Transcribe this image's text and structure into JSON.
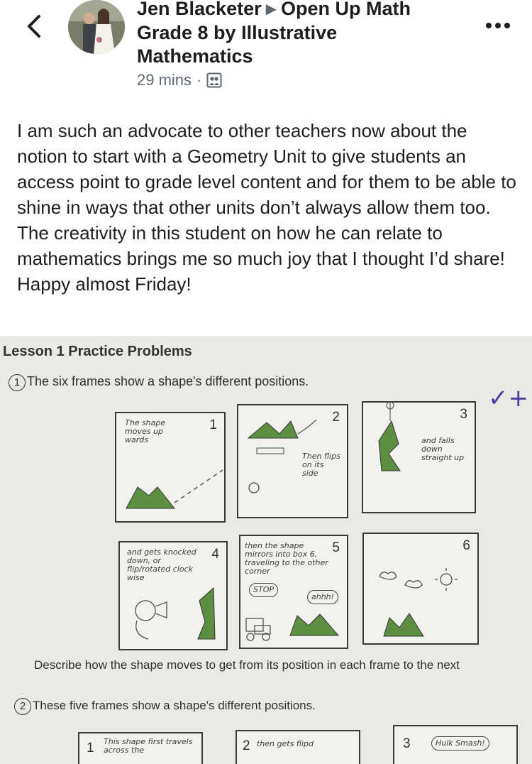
{
  "header": {
    "author": "Jen Blacketer",
    "group_line1": "Open Up Math",
    "group_line2": "Grade 8 by Illustrative",
    "group_line3": "Mathematics",
    "time": "29 mins",
    "dot": "·"
  },
  "post": {
    "text": "I am such an advocate to other teachers now about the notion to start with a Geometry Unit to give students an access point to grade level content and for them to be able to shine in ways that other units don’t always allow them too. The creativity in this student on how he can relate to mathematics brings me so much joy that I thought I’d share! Happy almost Friday!"
  },
  "worksheet": {
    "title": "Lesson 1 Practice Problems",
    "q1_num": "1",
    "q1_text": "The six frames show a shape's different positions.",
    "describe": "Describe how the shape moves to get from its position in each frame to the next",
    "q2_num": "2",
    "q2_text": "These five frames show a shape's different positions.",
    "frame_numbers": [
      "1",
      "2",
      "3",
      "4",
      "5",
      "6"
    ],
    "frame_numbers_q2": [
      "1",
      "2",
      "3"
    ],
    "check_mark": "✓+",
    "handwriting": {
      "f1": "The shape moves up wards",
      "f2": "Then flips on its side",
      "f3": "and falls down straight up",
      "f4": "and gets knocked down, or flip/rotated clock wise",
      "f5": "then the shape mirrors into box 6, traveling to the other corner",
      "f5_stop": "STOP",
      "f5_ahh": "ahhh!",
      "q2f1": "This shape first travels across the",
      "q2f2": "then gets flipd",
      "q2f3": "Hulk Smash!"
    }
  },
  "icons": {
    "back": "chevron-left-icon",
    "more": "more-dots-icon",
    "group": "group-icon"
  }
}
